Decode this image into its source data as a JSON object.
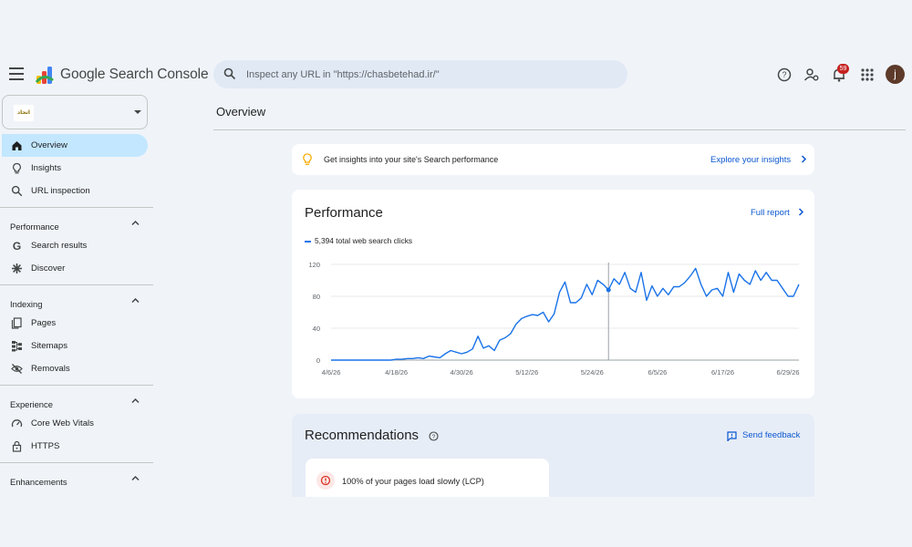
{
  "header": {
    "app_title": "Google Search Console",
    "search_placeholder": "Inspect any URL in \"https://chasbetehad.ir/\"",
    "notification_count": "59",
    "avatar_initial": "j"
  },
  "sidebar": {
    "property_label": "اتحاد",
    "nav_top": [
      {
        "label": "Overview",
        "icon": "home-icon",
        "active": true
      },
      {
        "label": "Insights",
        "icon": "lightbulb-icon"
      },
      {
        "label": "URL inspection",
        "icon": "search-icon"
      }
    ],
    "sections": [
      {
        "title": "Performance",
        "items": [
          {
            "label": "Search results",
            "icon": "google-g-icon"
          },
          {
            "label": "Discover",
            "icon": "asterisk-icon"
          }
        ]
      },
      {
        "title": "Indexing",
        "items": [
          {
            "label": "Pages",
            "icon": "pages-icon"
          },
          {
            "label": "Sitemaps",
            "icon": "sitemap-icon"
          },
          {
            "label": "Removals",
            "icon": "eye-off-icon"
          }
        ]
      },
      {
        "title": "Experience",
        "items": [
          {
            "label": "Core Web Vitals",
            "icon": "gauge-icon"
          },
          {
            "label": "HTTPS",
            "icon": "lock-icon"
          }
        ]
      },
      {
        "title": "Enhancements",
        "items": []
      }
    ]
  },
  "main": {
    "page_title": "Overview",
    "insights_banner": {
      "text": "Get insights into your site's Search performance",
      "link": "Explore your insights"
    },
    "performance": {
      "title": "Performance",
      "link": "Full report",
      "legend": "5,394 total web search clicks"
    },
    "recommendations": {
      "title": "Recommendations",
      "feedback": "Send feedback",
      "item": "100% of your pages load slowly (LCP)"
    }
  },
  "colors": {
    "accent_blue": "#1a73e8",
    "link_blue": "#0b57d0",
    "active_nav": "#c2e7ff",
    "background": "#f0f4f9",
    "badge_red": "#c5221f"
  },
  "chart_data": {
    "type": "line",
    "series": [
      {
        "values": [
          0,
          0,
          0,
          0,
          0,
          0,
          0,
          0,
          0,
          0,
          0,
          0,
          1,
          1,
          2,
          2,
          3,
          2,
          5,
          4,
          3,
          8,
          12,
          10,
          8,
          10,
          14,
          30,
          15,
          18,
          12,
          25,
          28,
          33,
          45,
          52,
          55,
          57,
          56,
          60,
          48,
          58,
          85,
          98,
          72,
          72,
          78,
          95,
          82,
          100,
          95,
          88,
          102,
          95,
          110,
          90,
          85,
          110,
          75,
          93,
          80,
          90,
          82,
          92,
          92,
          97,
          105,
          115,
          95,
          80,
          88,
          90,
          80,
          110,
          85,
          108,
          100,
          95,
          112,
          100,
          110,
          100,
          100,
          90,
          80,
          80,
          95
        ]
      }
    ],
    "x_tick_labels": [
      "4/6/26",
      "4/18/26",
      "4/30/26",
      "5/12/26",
      "5/24/26",
      "6/5/26",
      "6/17/26",
      "6/29/26"
    ],
    "y_tick_labels": [
      "0",
      "40",
      "80",
      "120"
    ],
    "ylim": [
      0,
      120
    ],
    "highlight_index": 51,
    "grid": "horizontal"
  }
}
